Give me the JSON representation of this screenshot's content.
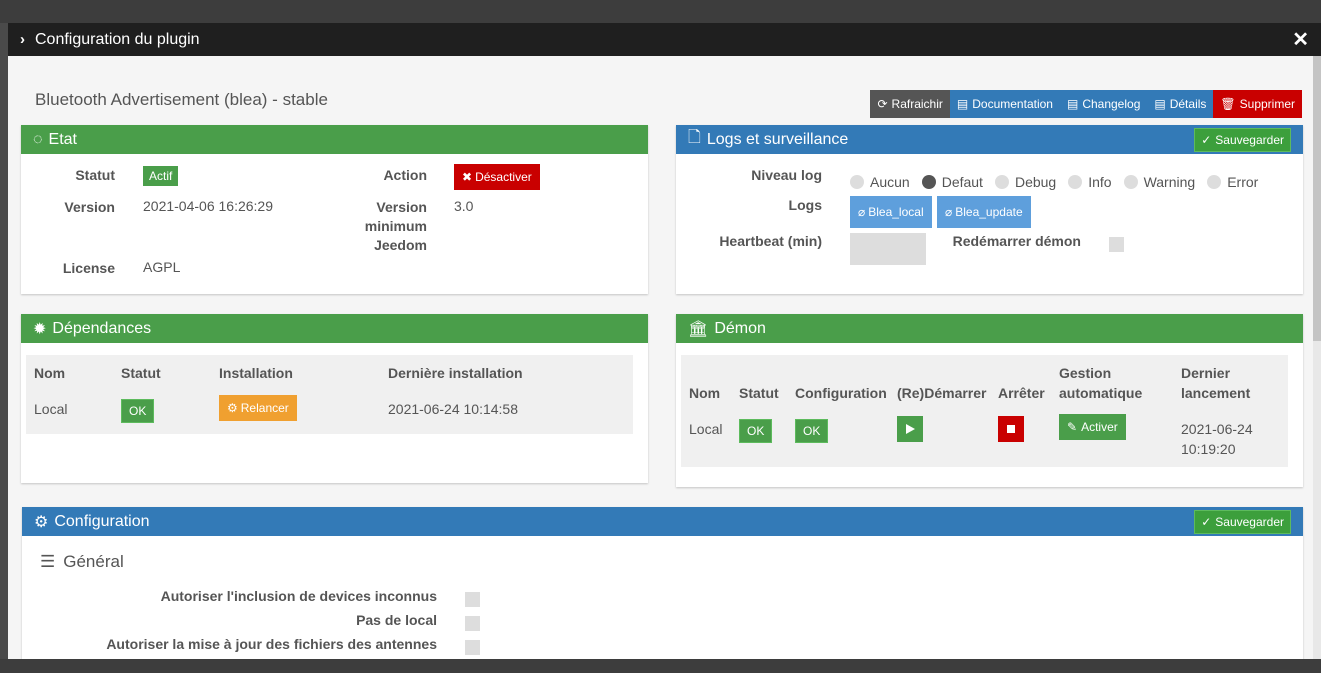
{
  "modal": {
    "title": "Configuration du plugin"
  },
  "plugin": {
    "title": "Bluetooth Advertisement (blea) - stable"
  },
  "toolbar": {
    "refresh": "Rafraichir",
    "documentation": "Documentation",
    "changelog": "Changelog",
    "details": "Détails",
    "delete": "Supprimer"
  },
  "etat": {
    "title": "Etat",
    "statut_label": "Statut",
    "statut_value": "Actif",
    "action_label": "Action",
    "action_button": "Désactiver",
    "version_label": "Version",
    "version_value": "2021-04-06 16:26:29",
    "version_min_label_1": "Version",
    "version_min_label_2": "minimum",
    "version_min_label_3": "Jeedom",
    "version_min_value": "3.0",
    "license_label": "License",
    "license_value": "AGPL"
  },
  "logs": {
    "title": "Logs et surveillance",
    "save": "Sauvegarder",
    "niveau_label": "Niveau log",
    "levels": [
      "Aucun",
      "Defaut",
      "Debug",
      "Info",
      "Warning",
      "Error"
    ],
    "selected_level": "Defaut",
    "logs_label": "Logs",
    "log_buttons": [
      "Blea_local",
      "Blea_update"
    ],
    "heartbeat_label": "Heartbeat (min)",
    "heartbeat_value": "",
    "restart_label": "Redémarrer démon"
  },
  "deps": {
    "title": "Dépendances",
    "headers": [
      "Nom",
      "Statut",
      "Installation",
      "Dernière installation"
    ],
    "row": {
      "nom": "Local",
      "statut": "OK",
      "action": "Relancer",
      "date": "2021-06-24 10:14:58"
    }
  },
  "demon": {
    "title": "Démon",
    "headers": [
      "Nom",
      "Statut",
      "Configuration",
      "(Re)Démarrer",
      "Arrêter"
    ],
    "header_gestion_1": "Gestion",
    "header_gestion_2": "automatique",
    "header_dernier_1": "Dernier",
    "header_dernier_2": "lancement",
    "row": {
      "nom": "Local",
      "statut": "OK",
      "config": "OK",
      "gestion": "Activer",
      "date_1": "2021-06-24",
      "date_2": "10:19:20"
    }
  },
  "config": {
    "title": "Configuration",
    "save": "Sauvegarder",
    "section": "Général",
    "options": [
      "Autoriser l'inclusion de devices inconnus",
      "Pas de local",
      "Autoriser la mise à jour des fichiers des antennes"
    ]
  }
}
